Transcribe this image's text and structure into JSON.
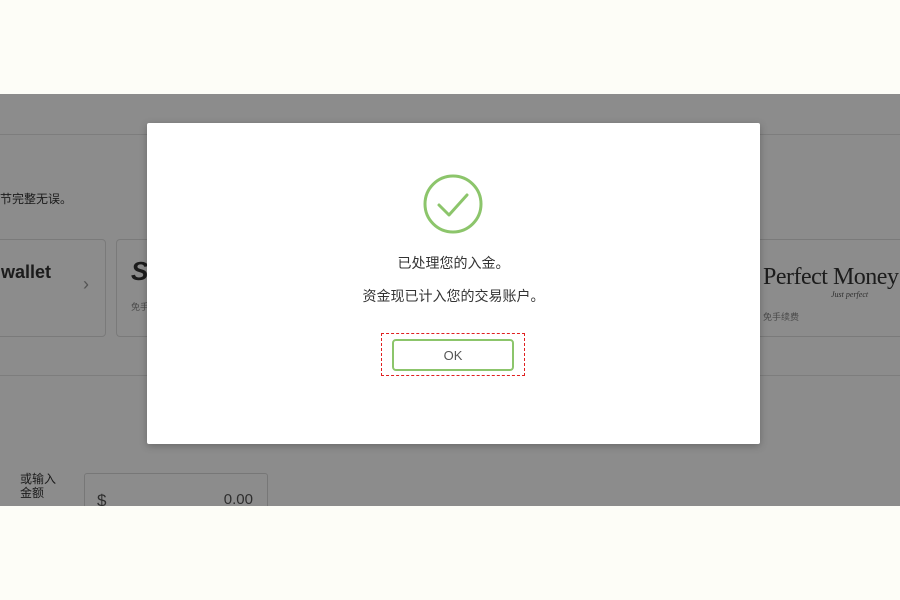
{
  "background": {
    "hint_text": "节完整无误。",
    "cards": {
      "wallet": {
        "name": "wallet"
      },
      "skrill": {
        "logo": "S",
        "sub": "免手"
      },
      "perfect_money": {
        "name": "Perfect Money",
        "tagline": "Just perfect",
        "fee": "免手续费"
      }
    },
    "amount": {
      "label": "或输入金额",
      "currency": "$",
      "value": "0.00"
    }
  },
  "dialog": {
    "line1": "已处理您的入金。",
    "line2": "资金现已计入您的交易账户。",
    "ok_label": "OK"
  },
  "colors": {
    "accent_green": "#8cc56b",
    "highlight_red": "#e02020",
    "overlay": "rgba(0,0,0,0.45)"
  }
}
